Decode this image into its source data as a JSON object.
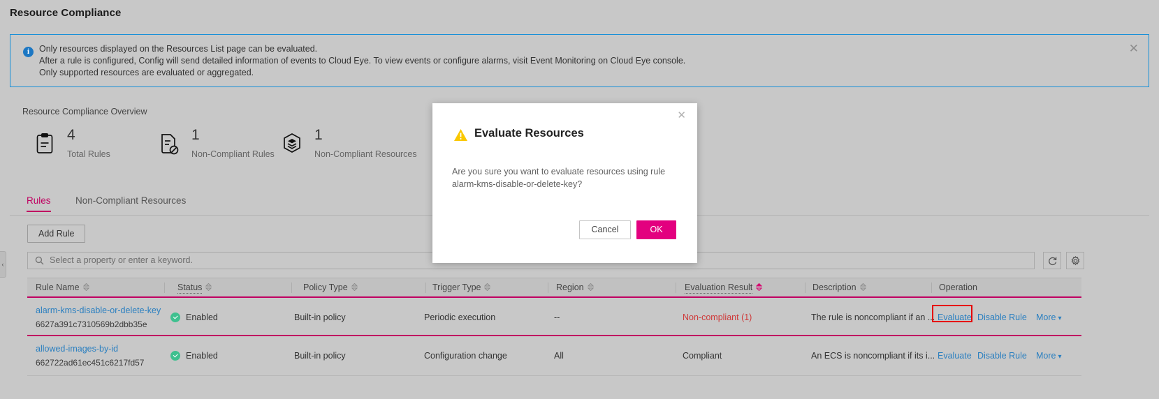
{
  "page": {
    "title": "Resource Compliance"
  },
  "banner": {
    "icon": "info-icon",
    "lines": [
      "Only resources displayed on the Resources List page can be evaluated.",
      "After a rule is configured, Config will send detailed information of events to Cloud Eye. To view events or configure alarms, visit Event Monitoring on Cloud Eye console.",
      "Only supported resources are evaluated or aggregated."
    ],
    "close_label": "✕",
    "border_color": "#1890d8"
  },
  "overview": {
    "title": "Resource Compliance Overview",
    "stats": [
      {
        "icon": "clipboard-icon",
        "value": "4",
        "label": "Total Rules"
      },
      {
        "icon": "document-blocked-icon",
        "value": "1",
        "label": "Non-Compliant Rules"
      },
      {
        "icon": "layers-hexagon-icon",
        "value": "1",
        "label": "Non-Compliant Resources"
      }
    ]
  },
  "panel": {
    "tabs": [
      {
        "label": "Rules",
        "active": true
      },
      {
        "label": "Non-Compliant Resources",
        "active": false
      }
    ],
    "add_rule_label": "Add Rule",
    "search": {
      "placeholder": "Select a property or enter a keyword.",
      "icon": "search-icon"
    },
    "toolbar_icons": [
      {
        "name": "refresh-icon"
      },
      {
        "name": "settings-gear-icon"
      }
    ]
  },
  "table": {
    "columns": [
      {
        "label": "Rule Name",
        "sortable": true,
        "filterable": false,
        "sort_active": false
      },
      {
        "label": "Status",
        "sortable": true,
        "filterable": true,
        "sort_active": false
      },
      {
        "label": "Policy Type",
        "sortable": true,
        "filterable": false,
        "sort_active": false
      },
      {
        "label": "Trigger Type",
        "sortable": true,
        "filterable": false,
        "sort_active": false
      },
      {
        "label": "Region",
        "sortable": true,
        "filterable": false,
        "sort_active": false
      },
      {
        "label": "Evaluation Result",
        "sortable": true,
        "filterable": true,
        "sort_active": true
      },
      {
        "label": "Description",
        "sortable": true,
        "filterable": false,
        "sort_active": false
      },
      {
        "label": "Operation",
        "sortable": false,
        "filterable": false,
        "sort_active": false
      }
    ],
    "rows": [
      {
        "name": "alarm-kms-disable-or-delete-key",
        "id": "6627a391c7310569b2dbb35e",
        "status": "Enabled",
        "policy_type": "Built-in policy",
        "trigger_type": "Periodic execution",
        "region": "--",
        "evaluation_result": "Non-compliant (1)",
        "evaluation_noncompliant": true,
        "description": "The rule is noncompliant if an ...",
        "operations": [
          "Evaluate",
          "Disable Rule",
          "More"
        ],
        "selected": true,
        "highlight_operation": "Evaluate"
      },
      {
        "name": "allowed-images-by-id",
        "id": "662722ad61ec451c6217fd57",
        "status": "Enabled",
        "policy_type": "Built-in policy",
        "trigger_type": "Configuration change",
        "region": "All",
        "evaluation_result": "Compliant",
        "evaluation_noncompliant": false,
        "description": "An ECS is noncompliant if its i...",
        "operations": [
          "Evaluate",
          "Disable Rule",
          "More"
        ],
        "selected": false,
        "highlight_operation": null
      }
    ]
  },
  "modal": {
    "icon": "warning-triangle-icon",
    "title": "Evaluate Resources",
    "body": "Are you sure you want to evaluate resources using rule alarm-kms-disable-or-delete-key?",
    "cancel_label": "Cancel",
    "ok_label": "OK",
    "close_label": "✕",
    "ok_color": "#e3007f"
  },
  "collapse_handle": {
    "label": "‹"
  }
}
